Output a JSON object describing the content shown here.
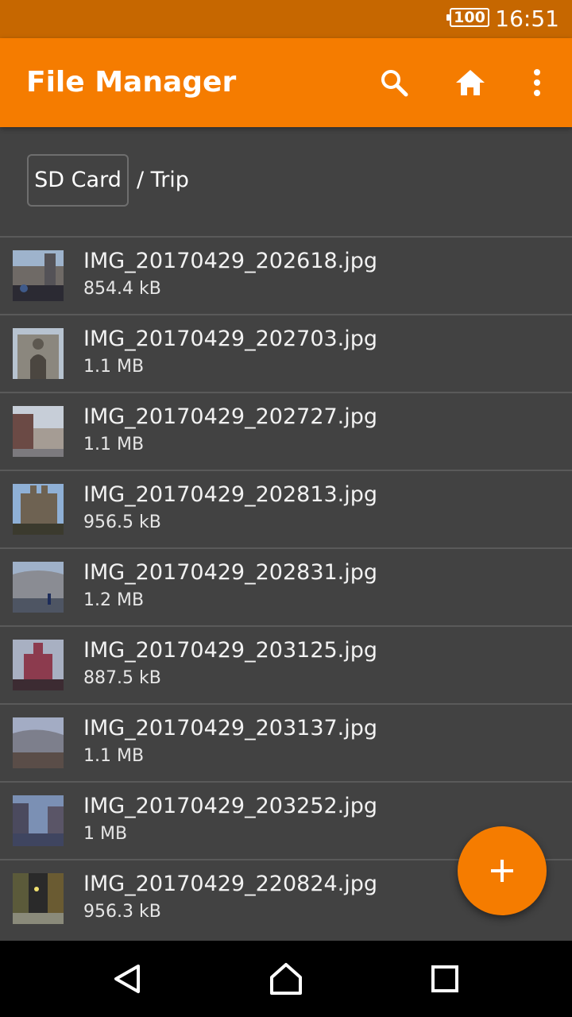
{
  "status": {
    "battery": "100",
    "time": "16:51"
  },
  "toolbar": {
    "title": "File Manager",
    "icons": [
      "search-icon",
      "home-icon",
      "more-vert-icon"
    ]
  },
  "breadcrumb": {
    "root": "SD Card",
    "path": "/ Trip"
  },
  "files": [
    {
      "name": "IMG_20170429_202618.jpg",
      "size": "854.4 kB"
    },
    {
      "name": "IMG_20170429_202703.jpg",
      "size": "1.1 MB"
    },
    {
      "name": "IMG_20170429_202727.jpg",
      "size": "1.1 MB"
    },
    {
      "name": "IMG_20170429_202813.jpg",
      "size": "956.5 kB"
    },
    {
      "name": "IMG_20170429_202831.jpg",
      "size": "1.2 MB"
    },
    {
      "name": "IMG_20170429_203125.jpg",
      "size": "887.5 kB"
    },
    {
      "name": "IMG_20170429_203137.jpg",
      "size": "1.1 MB"
    },
    {
      "name": "IMG_20170429_203252.jpg",
      "size": "1 MB"
    },
    {
      "name": "IMG_20170429_220824.jpg",
      "size": "956.3 kB"
    }
  ],
  "fab": {
    "icon": "add-icon"
  },
  "colors": {
    "accent": "#f57c00",
    "statusbar": "#c66700",
    "background": "#424242"
  }
}
